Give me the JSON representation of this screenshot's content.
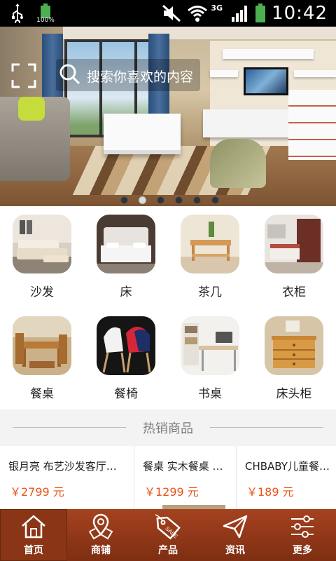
{
  "status_bar": {
    "battery_percent": "100%",
    "network": "3G",
    "time": "10:42"
  },
  "search": {
    "placeholder": "搜索你喜欢的内容"
  },
  "banner": {
    "dot_count": 6,
    "active_dot": 1
  },
  "categories": [
    {
      "label": "沙发"
    },
    {
      "label": "床"
    },
    {
      "label": "茶几"
    },
    {
      "label": "衣柜"
    },
    {
      "label": "餐桌"
    },
    {
      "label": "餐椅"
    },
    {
      "label": "书桌"
    },
    {
      "label": "床头柜"
    }
  ],
  "hot": {
    "title": "热销商品"
  },
  "products": [
    {
      "name": "银月亮 布艺沙发客厅…",
      "price": "￥2799 元"
    },
    {
      "name": "餐桌 实木餐桌 …",
      "price": "￥1299 元"
    },
    {
      "name": "CHBABY儿童餐…",
      "price": "￥189 元"
    }
  ],
  "tabs": [
    {
      "label": "首页",
      "icon": "home-icon"
    },
    {
      "label": "商铺",
      "icon": "store-map-icon"
    },
    {
      "label": "产品",
      "icon": "sale-tag-icon"
    },
    {
      "label": "资讯",
      "icon": "send-icon"
    },
    {
      "label": "更多",
      "icon": "sliders-icon"
    }
  ],
  "colors": {
    "accent": "#8e3517",
    "price": "#e8531a",
    "battery": "#4caf50"
  }
}
